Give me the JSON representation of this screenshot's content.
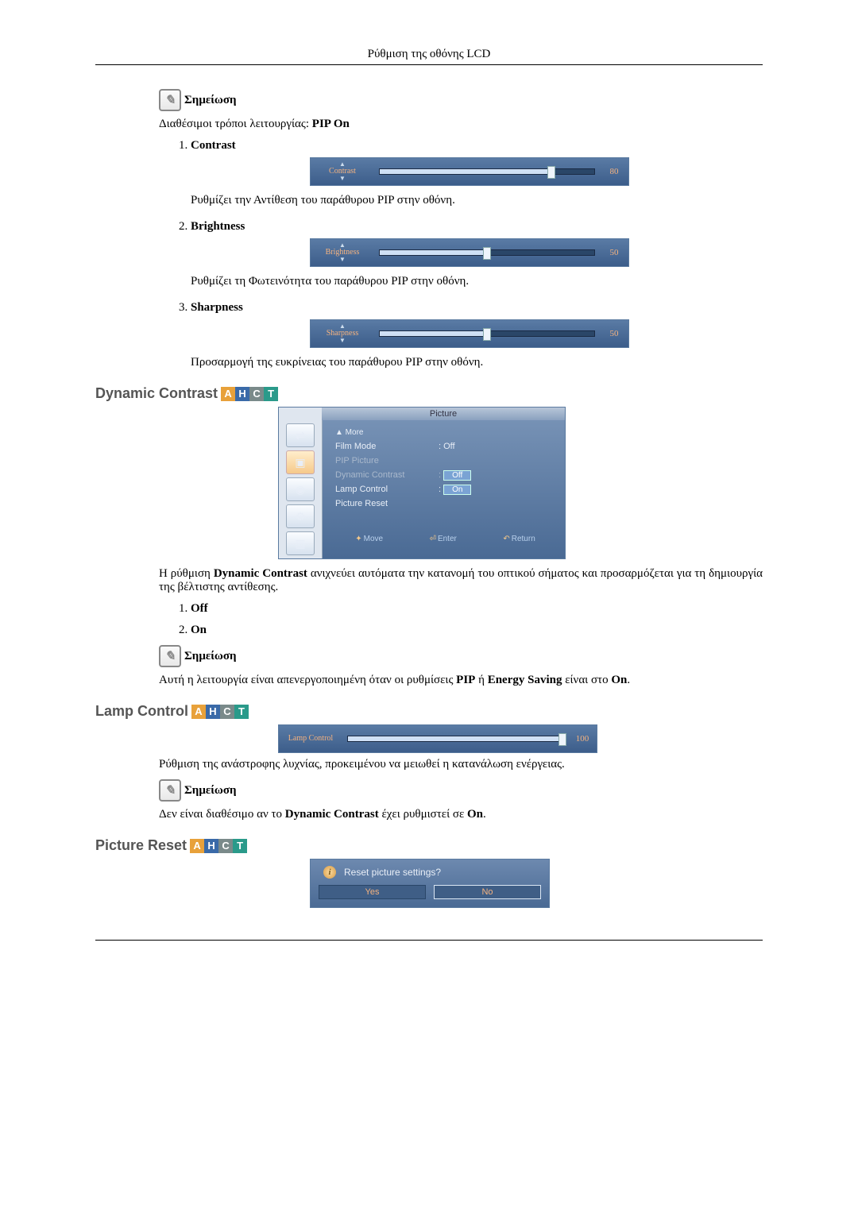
{
  "page_header": "Ρύθμιση της οθόνης LCD",
  "note_label": "Σημείωση",
  "note_icon_glyph": "✎",
  "modes_text_prefix": "Διαθέσιμοι τρόποι λειτουργίας: ",
  "modes_text_bold": "PIP On",
  "items": [
    {
      "title": "Contrast",
      "slider": {
        "label": "Contrast",
        "value": 80,
        "max": 100
      },
      "desc": "Ρυθμίζει την Αντίθεση του παράθυρου PIP στην οθόνη."
    },
    {
      "title": "Brightness",
      "slider": {
        "label": "Brightness",
        "value": 50,
        "max": 100
      },
      "desc": "Ρυθμίζει τη Φωτεινότητα του παράθυρου PIP στην οθόνη."
    },
    {
      "title": "Sharpness",
      "slider": {
        "label": "Sharpness",
        "value": 50,
        "max": 100
      },
      "desc": "Προσαρμογή της ευκρίνειας του παράθυρου PIP στην οθόνη."
    }
  ],
  "heading_dc": "Dynamic Contrast",
  "osd": {
    "title": "Picture",
    "items": [
      {
        "label": "▲   More",
        "value": "",
        "kind": "more"
      },
      {
        "label": "Film Mode",
        "value": ": Off",
        "kind": "normal"
      },
      {
        "label": "PIP Picture",
        "value": "",
        "kind": "dim"
      },
      {
        "label": "Dynamic Contrast",
        "value": "Off",
        "kind": "hl"
      },
      {
        "label": "Lamp Control",
        "value": "On",
        "kind": "hl2",
        "prefix": ": "
      },
      {
        "label": "Picture Reset",
        "value": "",
        "kind": "normal"
      }
    ],
    "footer": {
      "move": "Move",
      "enter": "Enter",
      "return": "Return"
    }
  },
  "dc_desc_1a": "Η ρύθμιση ",
  "dc_desc_1b": "Dynamic Contrast",
  "dc_desc_1c": " ανιχνεύει αυτόματα την κατανομή του οπτικού σήματος και προσαρμόζεται για τη δημιουργία της βέλτιστης αντίθεσης.",
  "dc_opts": [
    "Off",
    "On"
  ],
  "dc_note_a": "Αυτή η λειτουργία είναι απενεργοποιημένη όταν οι ρυθμίσεις ",
  "dc_note_b": "PIP",
  "dc_note_c": " ή ",
  "dc_note_d": "Energy Saving",
  "dc_note_e": " είναι στο ",
  "dc_note_f": "On",
  "dc_note_g": ".",
  "heading_lamp": "Lamp Control",
  "lamp_slider": {
    "label": "Lamp Control",
    "value": 100,
    "max": 100
  },
  "lamp_desc": "Ρύθμιση της ανάστροφης λυχνίας, προκειμένου να μειωθεί η κατανάλωση ενέργειας.",
  "lamp_note_a": "Δεν είναι διαθέσιμο αν το ",
  "lamp_note_b": "Dynamic Contrast",
  "lamp_note_c": " έχει ρυθμιστεί σε ",
  "lamp_note_d": "On",
  "lamp_note_e": ".",
  "heading_reset": "Picture Reset",
  "dialog": {
    "question": "Reset picture settings?",
    "yes": "Yes",
    "no": "No"
  },
  "badges": [
    "A",
    "H",
    "C",
    "T"
  ]
}
